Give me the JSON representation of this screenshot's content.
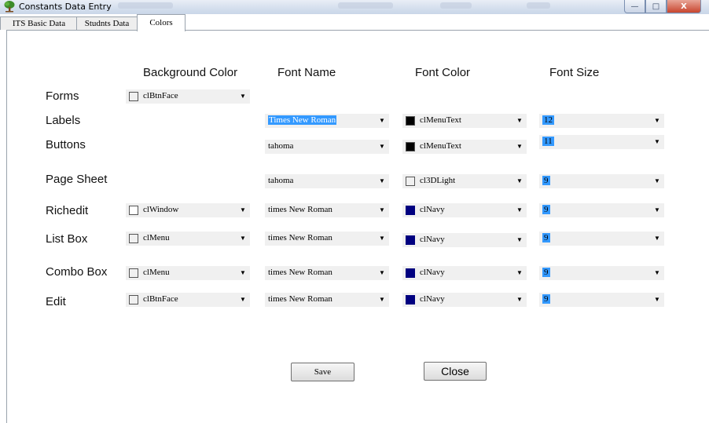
{
  "window": {
    "title": "Constants Data Entry",
    "buttons": {
      "minimize": "—",
      "maximize": "□",
      "close": "X"
    }
  },
  "tabs": [
    {
      "label": "ITS Basic Data",
      "active": false
    },
    {
      "label": "Studnts Data",
      "active": false
    },
    {
      "label": "Colors",
      "active": true
    }
  ],
  "headers": {
    "background_color": "Background Color",
    "font_name": "Font Name",
    "font_color": "Font Color",
    "font_size": "Font Size"
  },
  "rows": [
    {
      "label": "Forms",
      "background_color": "clBtnFace",
      "bg_swatch": "#f0f0f0"
    },
    {
      "label": "Labels",
      "font_name": "Times New Roman",
      "font_color": "clMenuText",
      "fc_swatch": "#000000",
      "font_size": "12"
    },
    {
      "label": "Buttons",
      "font_name": "tahoma",
      "font_color": "clMenuText",
      "fc_swatch": "#000000",
      "font_size": "11"
    },
    {
      "label": "Page Sheet",
      "font_name": "tahoma",
      "font_color": "cl3DLight",
      "fc_swatch": "#f0f0f0",
      "font_size": "9"
    },
    {
      "label": "Richedit",
      "background_color": "clWindow",
      "bg_swatch": "#ffffff",
      "font_name": "times New Roman",
      "font_color": "clNavy",
      "fc_swatch": "#000080",
      "font_size": "9"
    },
    {
      "label": "List Box",
      "background_color": "clMenu",
      "bg_swatch": "#f0f0f0",
      "font_name": "times New Roman",
      "font_color": "clNavy",
      "fc_swatch": "#000080",
      "font_size": "9"
    },
    {
      "label": "Combo Box",
      "background_color": "clMenu",
      "bg_swatch": "#f0f0f0",
      "font_name": "times New Roman",
      "font_color": "clNavy",
      "fc_swatch": "#000080",
      "font_size": "9"
    },
    {
      "label": "Edit",
      "background_color": "clBtnFace",
      "bg_swatch": "#f0f0f0",
      "font_name": "times New Roman",
      "font_color": "clNavy",
      "fc_swatch": "#000080",
      "font_size": "9"
    }
  ],
  "buttons": {
    "save": "Save",
    "close": "Close"
  },
  "colors": {
    "selection": "#3399ff",
    "combo_bg": "#f0f0f0",
    "navy": "#000080"
  }
}
